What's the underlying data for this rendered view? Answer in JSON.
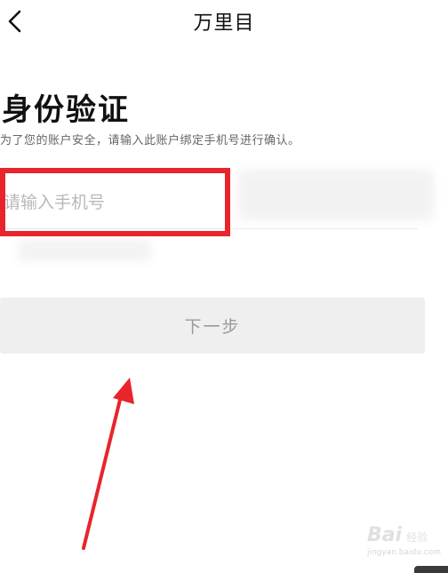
{
  "header": {
    "back_icon": "chevron-left-icon",
    "title": "万里目"
  },
  "verification": {
    "title": "身份验证",
    "subtitle": "为了您的账户安全，请输入此账户绑定手机号进行确认。",
    "phone_input": {
      "value": "",
      "placeholder": "请输入手机号"
    },
    "next_button_label": "下一步"
  },
  "annotations": {
    "highlight_color": "#e8242c",
    "arrow_color": "#e8242c"
  },
  "watermark": {
    "brand": "Bai",
    "brand_suffix": "经验",
    "url": "jingyan.baidu.com"
  },
  "colors": {
    "button_bg": "#efefef",
    "button_text": "#9a9a9a",
    "placeholder": "#b8b8b8"
  }
}
